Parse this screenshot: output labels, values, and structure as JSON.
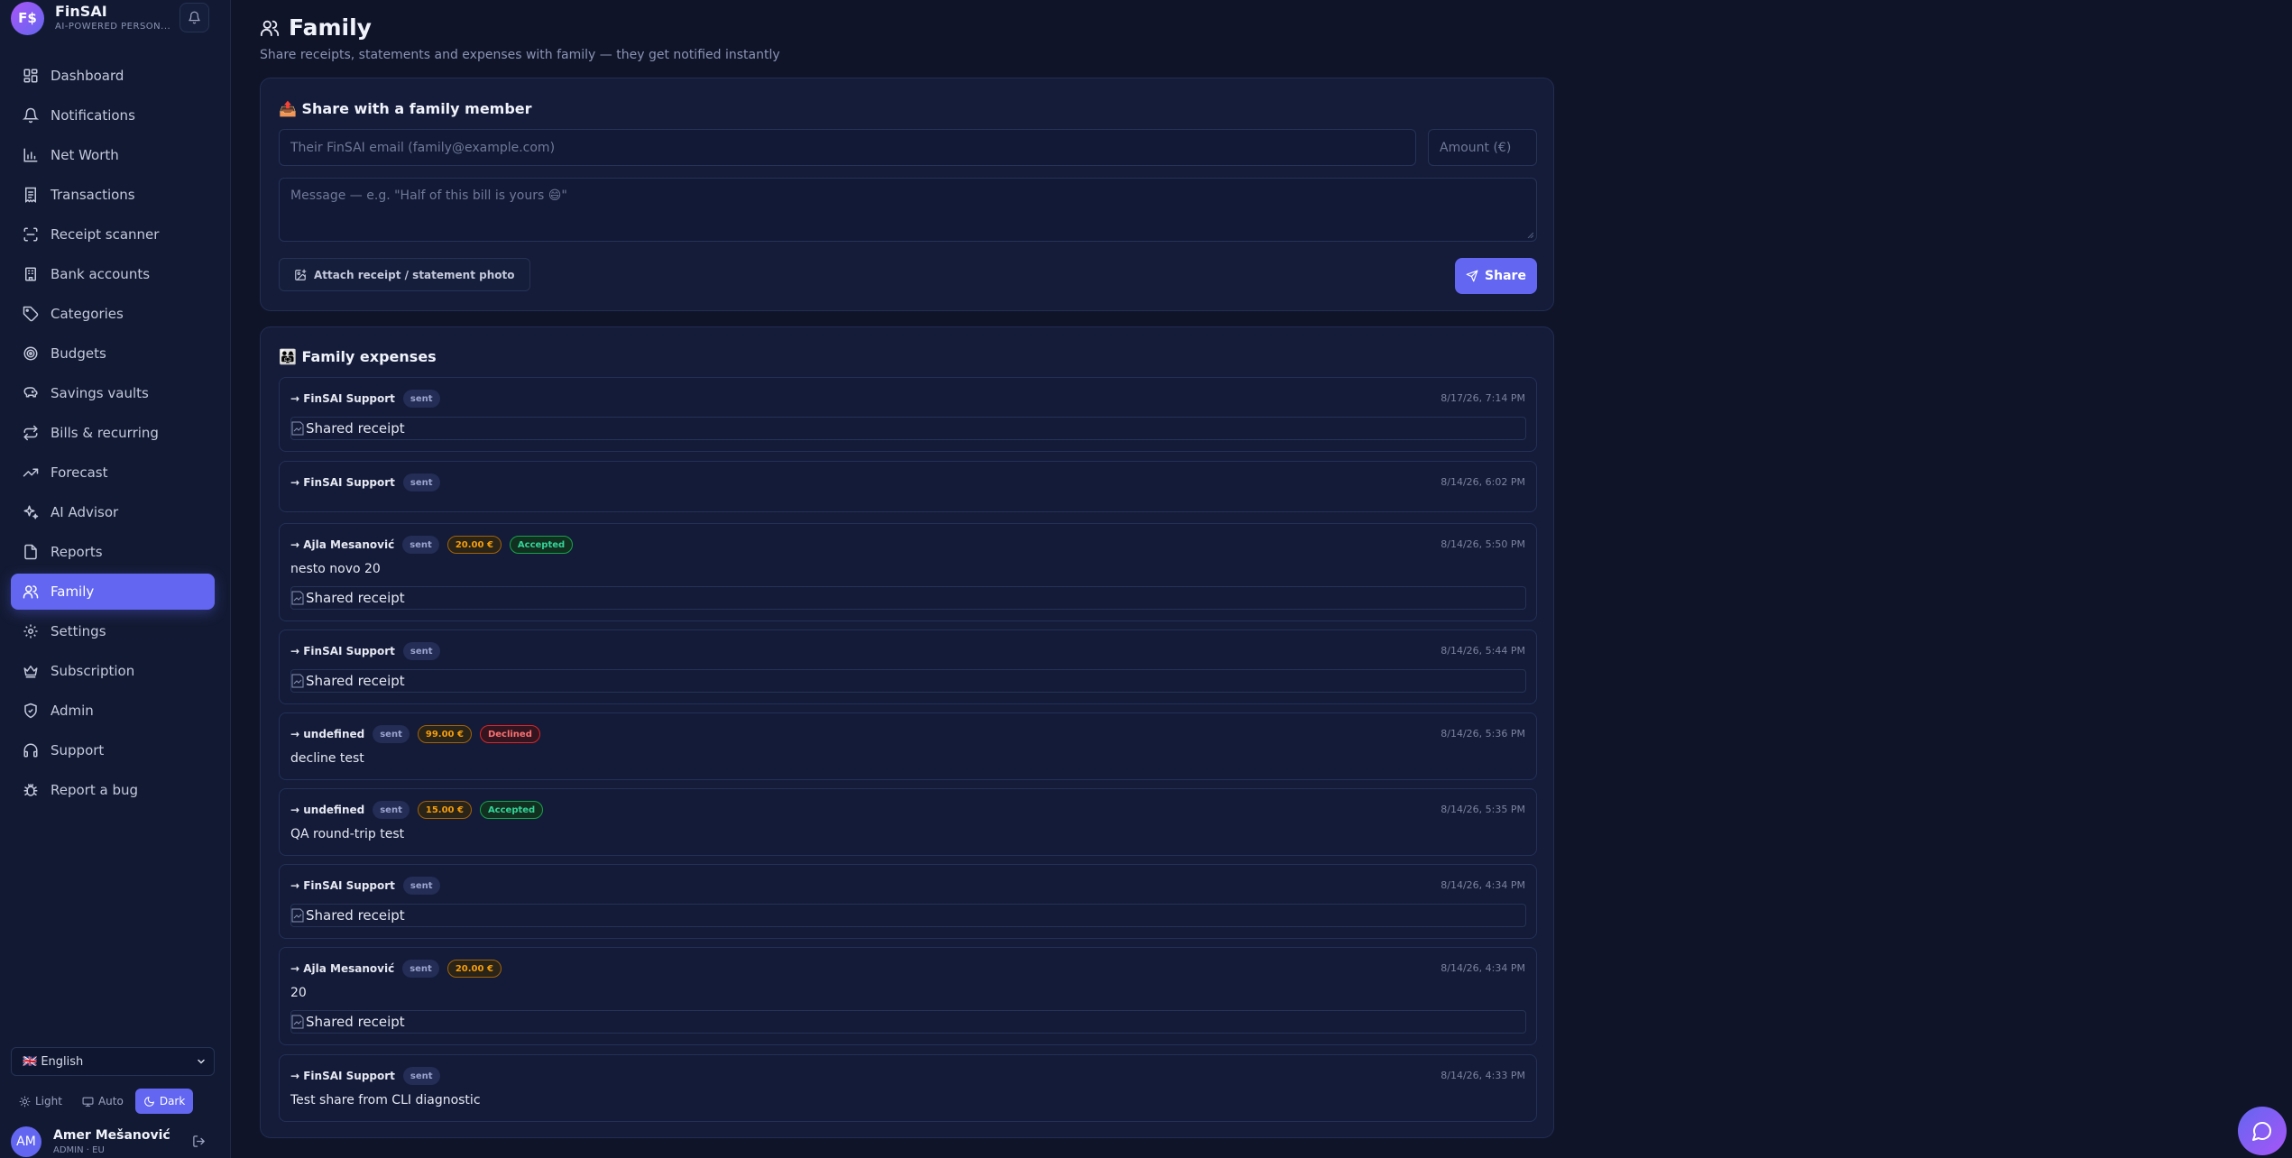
{
  "app": {
    "name": "FinSAI",
    "logo_text": "F$",
    "tagline": "AI-POWERED PERSON..."
  },
  "colors": {
    "accent": "#6366f1",
    "background": "#0f1429",
    "sidebar": "#121a33",
    "card": "#141c3a",
    "accepted": "#34d399",
    "declined": "#f87171",
    "amount": "#f59e0b"
  },
  "sidebar": {
    "items": [
      {
        "label": "Dashboard",
        "icon": "dashboard-icon"
      },
      {
        "label": "Notifications",
        "icon": "bell-icon"
      },
      {
        "label": "Net Worth",
        "icon": "bar-chart-icon"
      },
      {
        "label": "Transactions",
        "icon": "receipt-icon"
      },
      {
        "label": "Receipt scanner",
        "icon": "scan-icon"
      },
      {
        "label": "Bank accounts",
        "icon": "bank-icon"
      },
      {
        "label": "Categories",
        "icon": "tag-icon"
      },
      {
        "label": "Budgets",
        "icon": "target-icon"
      },
      {
        "label": "Savings vaults",
        "icon": "piggy-bank-icon"
      },
      {
        "label": "Bills & recurring",
        "icon": "repeat-icon"
      },
      {
        "label": "Forecast",
        "icon": "trending-up-icon"
      },
      {
        "label": "AI Advisor",
        "icon": "sparkles-icon"
      },
      {
        "label": "Reports",
        "icon": "file-icon"
      },
      {
        "label": "Family",
        "icon": "users-icon",
        "active": true
      },
      {
        "label": "Settings",
        "icon": "gear-icon"
      },
      {
        "label": "Subscription",
        "icon": "crown-icon"
      },
      {
        "label": "Admin",
        "icon": "shield-icon"
      },
      {
        "label": "Support",
        "icon": "headphones-icon"
      },
      {
        "label": "Report a bug",
        "icon": "bug-icon"
      }
    ],
    "language": "🇬🇧 English",
    "theme": {
      "light": "Light",
      "auto": "Auto",
      "dark": "Dark",
      "selected": "dark"
    },
    "user": {
      "initials": "AM",
      "name": "Amer Mešanović",
      "role": "ADMIN · EU"
    }
  },
  "page": {
    "title": "Family",
    "subtitle": "Share receipts, statements and expenses with family — they get notified instantly"
  },
  "share": {
    "title": "📤 Share with a family member",
    "email_placeholder": "Their FinSAI email (family@example.com)",
    "amount_placeholder": "Amount (€)",
    "message_placeholder": "Message — e.g. \"Half of this bill is yours 😄\"",
    "attach_label": "Attach receipt / statement photo",
    "share_label": "Share"
  },
  "expenses": {
    "title": "👨‍👩‍👧 Family expenses",
    "items": [
      {
        "recipient": "→ FinSAI Support",
        "status": "sent",
        "amount": null,
        "decision": null,
        "date": "8/17/26, 7:14 PM",
        "message": null,
        "receipt": "Shared receipt"
      },
      {
        "recipient": "→ FinSAI Support",
        "status": "sent",
        "amount": null,
        "decision": null,
        "date": "8/14/26, 6:02 PM",
        "message": null,
        "receipt": null
      },
      {
        "recipient": "→ Ajla Mesanović",
        "status": "sent",
        "amount": "20.00 €",
        "decision": "Accepted",
        "date": "8/14/26, 5:50 PM",
        "message": "nesto novo 20",
        "receipt": "Shared receipt"
      },
      {
        "recipient": "→ FinSAI Support",
        "status": "sent",
        "amount": null,
        "decision": null,
        "date": "8/14/26, 5:44 PM",
        "message": null,
        "receipt": "Shared receipt"
      },
      {
        "recipient": "→ undefined",
        "status": "sent",
        "amount": "99.00 €",
        "decision": "Declined",
        "date": "8/14/26, 5:36 PM",
        "message": "decline test",
        "receipt": null
      },
      {
        "recipient": "→ undefined",
        "status": "sent",
        "amount": "15.00 €",
        "decision": "Accepted",
        "date": "8/14/26, 5:35 PM",
        "message": "QA round-trip test",
        "receipt": null
      },
      {
        "recipient": "→ FinSAI Support",
        "status": "sent",
        "amount": null,
        "decision": null,
        "date": "8/14/26, 4:34 PM",
        "message": null,
        "receipt": "Shared receipt"
      },
      {
        "recipient": "→ Ajla Mesanović",
        "status": "sent",
        "amount": "20.00 €",
        "decision": null,
        "date": "8/14/26, 4:34 PM",
        "message": "20",
        "receipt": "Shared receipt"
      },
      {
        "recipient": "→ FinSAI Support",
        "status": "sent",
        "amount": null,
        "decision": null,
        "date": "8/14/26, 4:33 PM",
        "message": "Test share from CLI diagnostic",
        "receipt": null
      }
    ]
  }
}
